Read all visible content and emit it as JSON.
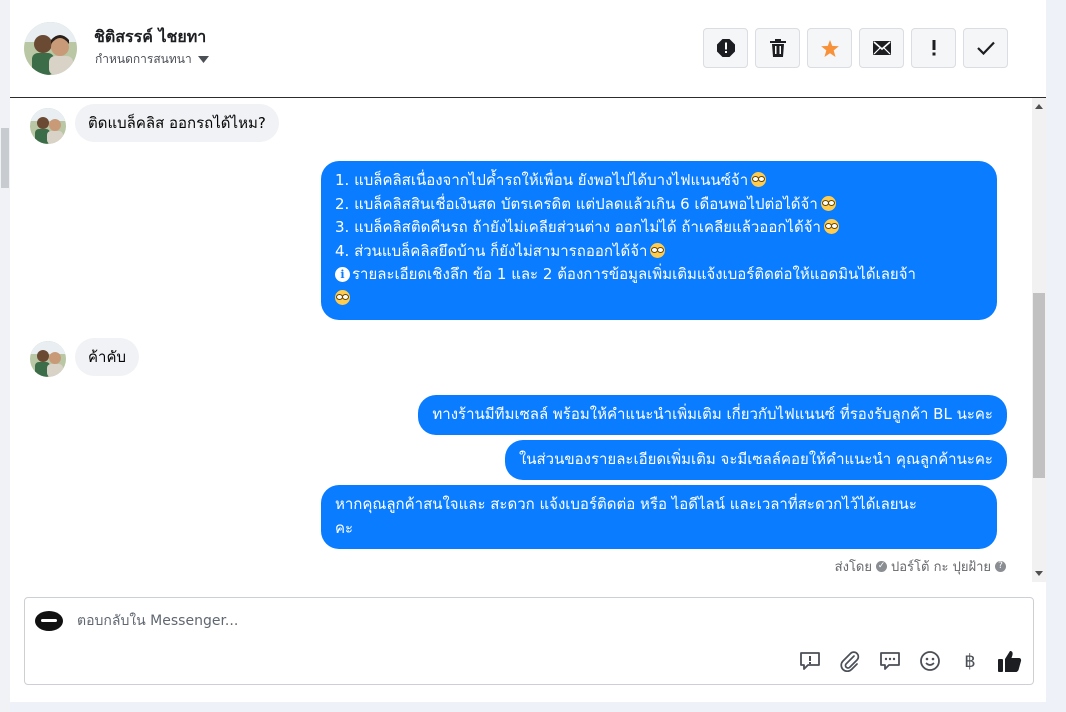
{
  "header": {
    "contact_name": "ชิติสรรค์ ไชยทา",
    "conversation_status": "กำหนดการสนทนา",
    "actions": [
      "report-icon",
      "trash-icon",
      "star-icon",
      "envelope-icon",
      "exclamation-icon",
      "check-icon"
    ]
  },
  "messages": [
    {
      "direction": "incoming",
      "text": "ติดแบล็คลิส ออกรถได้ไหม?"
    },
    {
      "direction": "outgoing",
      "lines": [
        "1. แบล็คลิสเนื่องจากไปค้ำรถให้เพื่อน ยังพอไปได้บางไฟแนนซ์จ้า",
        "2. แบล็คลิสสินเชื่อเงินสด บัตรเครดิต แต่ปลดแล้วเกิน 6 เดือนพอไปต่อได้จ้า",
        "3. แบล็คลิสติดคืนรถ ถ้ายังไม่เคลียส่วนต่าง ออกไม่ได้ ถ้าเคลียแล้วออกได้จ้า",
        "4. ส่วนแบล็คลิสยึดบ้าน ก็ยังไม่สามารถออกได้จ้า",
        "รายละเอียดเชิงลึก ข้อ 1 และ 2 ต้องการข้อมูลเพิ่มเติมแจ้งเบอร์ติดต่อให้แอดมินได้เลยจ้า"
      ]
    },
    {
      "direction": "incoming",
      "text": "ค้าคับ"
    },
    {
      "direction": "outgoing",
      "text": "ทางร้านมีทีมเซลล์ พร้อมให้คำแนะนำเพิ่มเติม เกี่ยวกับไฟแนนซ์ ที่รองรับลูกค้า BL นะคะ"
    },
    {
      "direction": "outgoing",
      "text": "ในส่วนของรายละเอียดเพิ่มเติม จะมีเซลล์คอยให้คำแนะนำ คุณลูกค้านะคะ"
    },
    {
      "direction": "outgoing",
      "lines": [
        "หากคุณลูกค้าสนใจและ สะดวก แจ้งเบอร์ติดต่อ หรือ ไอดีไลน์ และเวลาที่สะดวกไว้ได้เลยนะ",
        "คะ"
      ]
    }
  ],
  "sent_by": {
    "prefix": "ส่งโดย",
    "name": "ปอร์โต้ กะ ปุยฝ้าย"
  },
  "composer": {
    "placeholder": "ตอบกลับใน Messenger...",
    "tools": [
      "saved-reply-icon",
      "attachment-icon",
      "chat-bubbles-icon",
      "emoji-icon",
      "baht-icon",
      "like-icon"
    ],
    "baht_symbol": "฿"
  },
  "colors": {
    "outgoing_bubble": "#0a7cff",
    "incoming_bubble": "#f0f2f5",
    "accent_star": "#f7923b"
  }
}
